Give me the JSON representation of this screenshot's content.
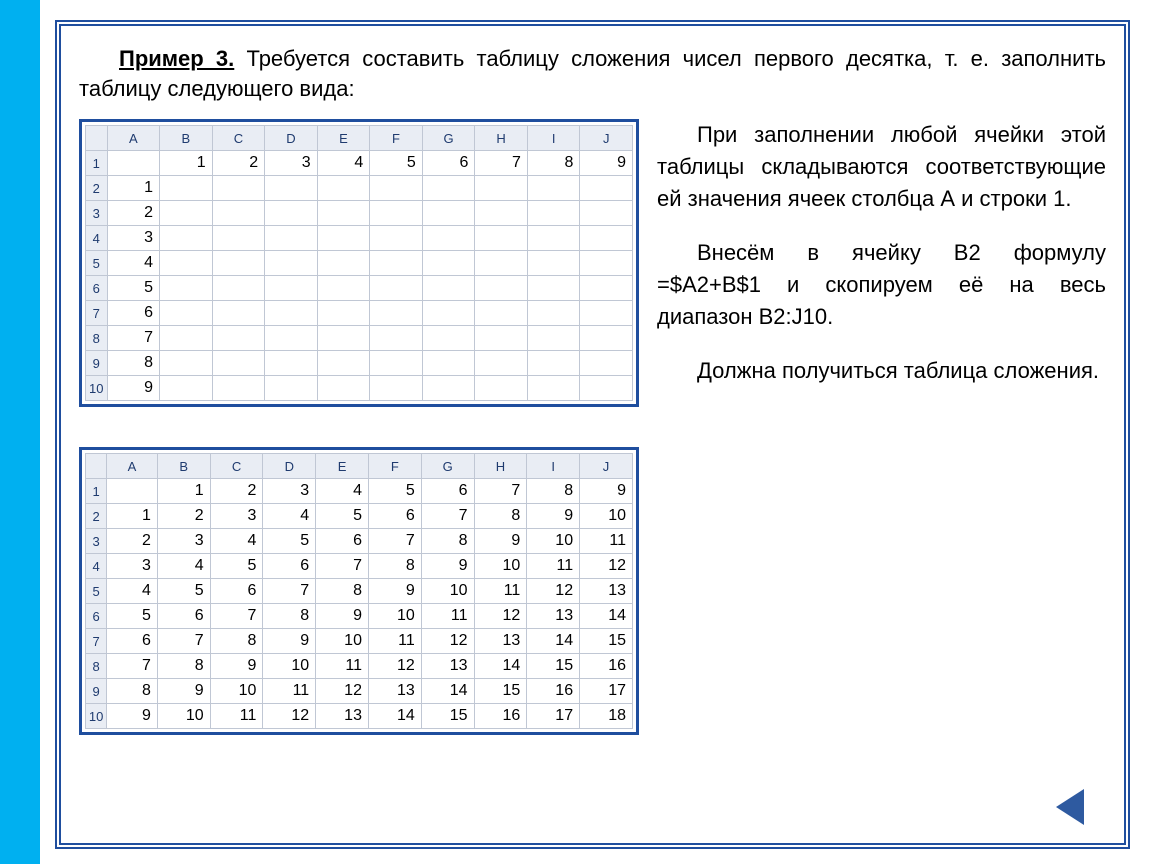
{
  "title": {
    "example_label": "Пример 3.",
    "text": "Требуется составить таблицу сложения чисел первого десятка, т. е. заполнить таблицу следующего вида:"
  },
  "paragraphs": {
    "p1": "При заполнении любой ячейки этой таблицы складываются соответствующие ей значения ячеек столбца А и строки 1.",
    "p2": "Внесём в ячейку В2 формулу =$A2+B$1 и скопируем её на весь диапазон B2:J10.",
    "p3": "Должна получиться таблица сложения."
  },
  "spreadsheet": {
    "columns": [
      "A",
      "B",
      "C",
      "D",
      "E",
      "F",
      "G",
      "H",
      "I",
      "J"
    ],
    "row_numbers": [
      1,
      2,
      3,
      4,
      5,
      6,
      7,
      8,
      9,
      10
    ]
  },
  "table_empty": {
    "header_row": [
      "",
      1,
      2,
      3,
      4,
      5,
      6,
      7,
      8,
      9
    ],
    "first_col": [
      1,
      2,
      3,
      4,
      5,
      6,
      7,
      8,
      9
    ]
  },
  "table_filled": {
    "header_row": [
      "",
      1,
      2,
      3,
      4,
      5,
      6,
      7,
      8,
      9
    ],
    "rows": [
      [
        1,
        2,
        3,
        4,
        5,
        6,
        7,
        8,
        9,
        10
      ],
      [
        2,
        3,
        4,
        5,
        6,
        7,
        8,
        9,
        10,
        11
      ],
      [
        3,
        4,
        5,
        6,
        7,
        8,
        9,
        10,
        11,
        12
      ],
      [
        4,
        5,
        6,
        7,
        8,
        9,
        10,
        11,
        12,
        13
      ],
      [
        5,
        6,
        7,
        8,
        9,
        10,
        11,
        12,
        13,
        14
      ],
      [
        6,
        7,
        8,
        9,
        10,
        11,
        12,
        13,
        14,
        15
      ],
      [
        7,
        8,
        9,
        10,
        11,
        12,
        13,
        14,
        15,
        16
      ],
      [
        8,
        9,
        10,
        11,
        12,
        13,
        14,
        15,
        16,
        17
      ],
      [
        9,
        10,
        11,
        12,
        13,
        14,
        15,
        16,
        17,
        18
      ]
    ]
  },
  "nav": {
    "back": "back"
  }
}
